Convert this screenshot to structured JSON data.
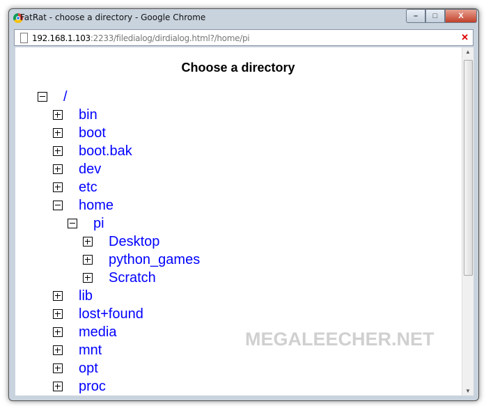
{
  "window": {
    "title": "FatRat - choose a directory - Google Chrome",
    "minimize": "–",
    "maximize": "□",
    "close": "X"
  },
  "address": {
    "host": "192.168.1.103",
    "rest": ":2233/filedialog/dirdialog.html?/home/pi"
  },
  "page": {
    "heading": "Choose a directory",
    "watermark": "MEGALEECHER.NET"
  },
  "tree": [
    {
      "label": "/",
      "level": 0,
      "expanded": true
    },
    {
      "label": "bin",
      "level": 1,
      "expanded": false
    },
    {
      "label": "boot",
      "level": 1,
      "expanded": false
    },
    {
      "label": "boot.bak",
      "level": 1,
      "expanded": false
    },
    {
      "label": "dev",
      "level": 1,
      "expanded": false
    },
    {
      "label": "etc",
      "level": 1,
      "expanded": false
    },
    {
      "label": "home",
      "level": 1,
      "expanded": true
    },
    {
      "label": "pi",
      "level": 2,
      "expanded": true
    },
    {
      "label": "Desktop",
      "level": 3,
      "expanded": false
    },
    {
      "label": "python_games",
      "level": 3,
      "expanded": false
    },
    {
      "label": "Scratch",
      "level": 3,
      "expanded": false
    },
    {
      "label": "lib",
      "level": 1,
      "expanded": false
    },
    {
      "label": "lost+found",
      "level": 1,
      "expanded": false
    },
    {
      "label": "media",
      "level": 1,
      "expanded": false
    },
    {
      "label": "mnt",
      "level": 1,
      "expanded": false
    },
    {
      "label": "opt",
      "level": 1,
      "expanded": false
    },
    {
      "label": "proc",
      "level": 1,
      "expanded": false
    }
  ]
}
